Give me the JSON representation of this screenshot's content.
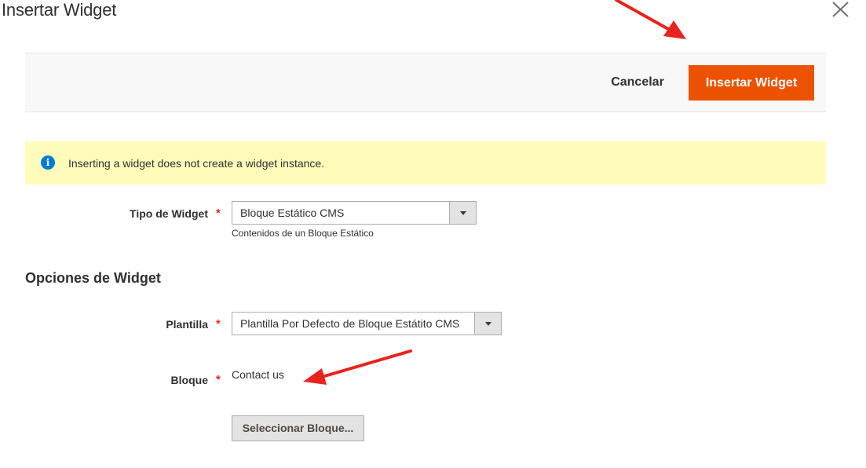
{
  "modal": {
    "title": "Insertar Widget",
    "close_icon": "close-icon"
  },
  "actions": {
    "cancel_label": "Cancelar",
    "insert_label": "Insertar Widget"
  },
  "notice": {
    "icon": "info-icon",
    "text": "Inserting a widget does not create a widget instance."
  },
  "widget_type": {
    "label": "Tipo de Widget",
    "required_mark": "*",
    "selected": "Bloque Estático CMS",
    "note": "Contenidos de un Bloque Estático"
  },
  "widget_options": {
    "section_title": "Opciones de Widget",
    "template": {
      "label": "Plantilla",
      "required_mark": "*",
      "selected": "Plantilla Por Defecto de Bloque Estátito CMS"
    },
    "block": {
      "label": "Bloque",
      "required_mark": "*",
      "value": "Contact us",
      "select_button_label": "Seleccionar Bloque..."
    }
  },
  "colors": {
    "primary": "#eb5202",
    "notice_bg": "#fffbbb",
    "info_icon": "#007bdb",
    "required": "#e22626",
    "annotation_arrow": "#e8231f"
  }
}
